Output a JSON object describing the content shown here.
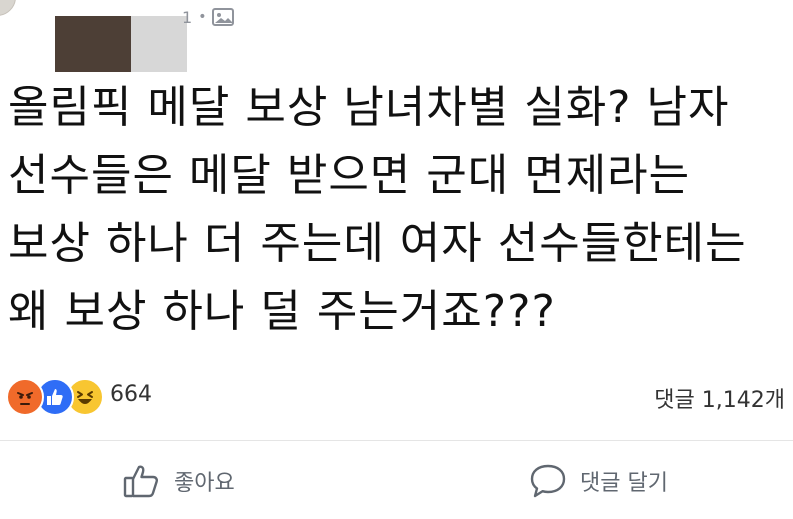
{
  "header": {
    "time_fragment": "1",
    "separator": "•",
    "privacy_icon": "photo-icon"
  },
  "post": {
    "lines": [
      "올림픽 메달 보상 남녀차별 실화? 남자",
      "선수들은 메달 받으면 군대 면제라는",
      "보상 하나 더 주는데 여자 선수들한테는",
      "왜 보상 하나 덜 주는거죠???"
    ]
  },
  "reactions": {
    "icons": [
      "angry-icon",
      "like-icon",
      "haha-icon"
    ],
    "count": "664",
    "comment_count": "댓글 1,142개"
  },
  "actions": {
    "like_label": "좋아요",
    "comment_label": "댓글 달기"
  },
  "colors": {
    "angry": "#f06a2a",
    "like": "#2f6df6",
    "haha": "#f8c631",
    "action_text": "#606770"
  }
}
